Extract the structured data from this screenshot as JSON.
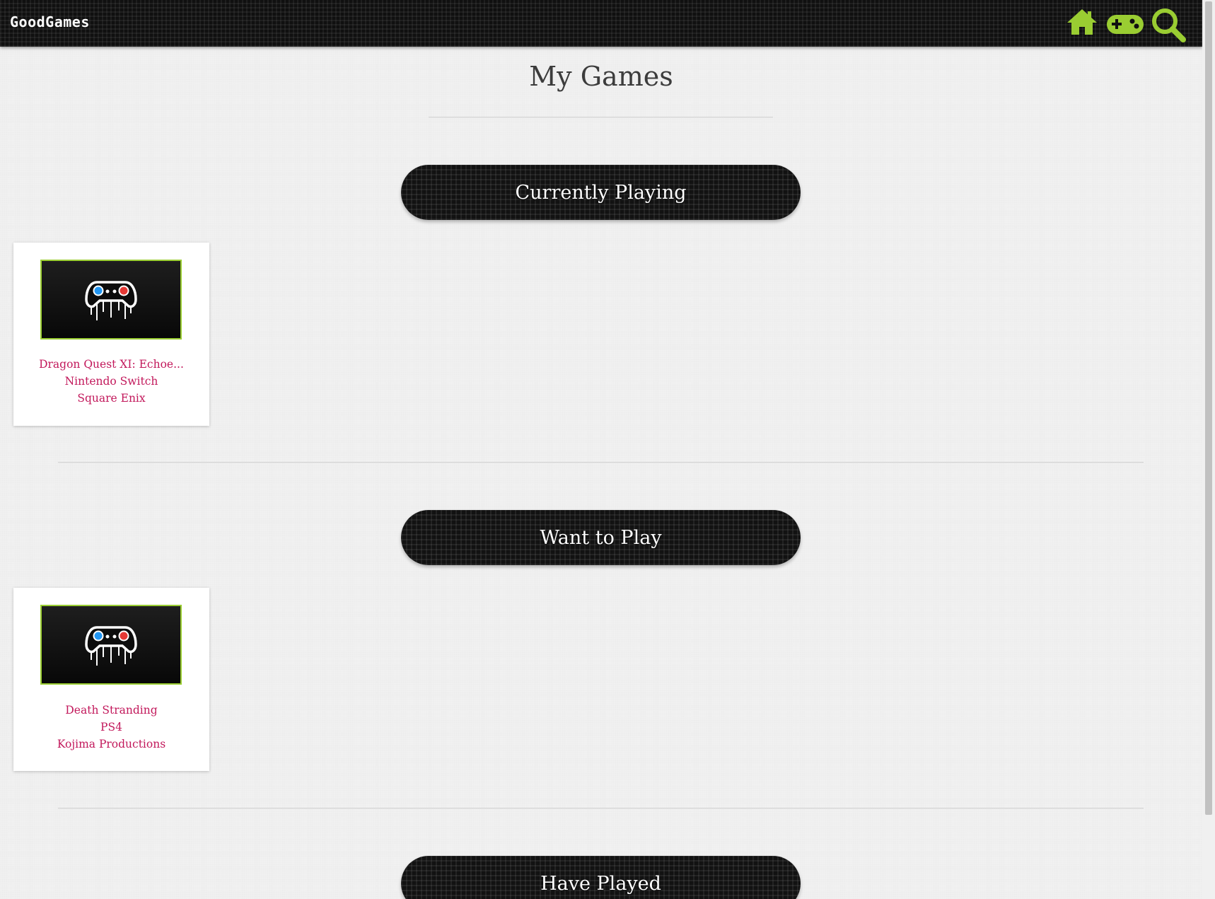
{
  "nav": {
    "brand": "GoodGames",
    "accent_color": "#9acd32",
    "icons": [
      "home-icon",
      "gamepad-add-icon",
      "search-icon"
    ]
  },
  "page": {
    "title": "My Games"
  },
  "sections": [
    {
      "title": "Currently Playing",
      "games": [
        {
          "title": "Dragon Quest XI: Echoe...",
          "platform": "Nintendo Switch",
          "publisher": "Square Enix"
        }
      ]
    },
    {
      "title": "Want to Play",
      "games": [
        {
          "title": "Death Stranding",
          "platform": "PS4",
          "publisher": "Kojima Productions"
        }
      ]
    },
    {
      "title": "Have Played",
      "games": []
    }
  ],
  "colors": {
    "link": "#c2185b",
    "pill_bg": "#121212",
    "accent": "#9acd32"
  }
}
